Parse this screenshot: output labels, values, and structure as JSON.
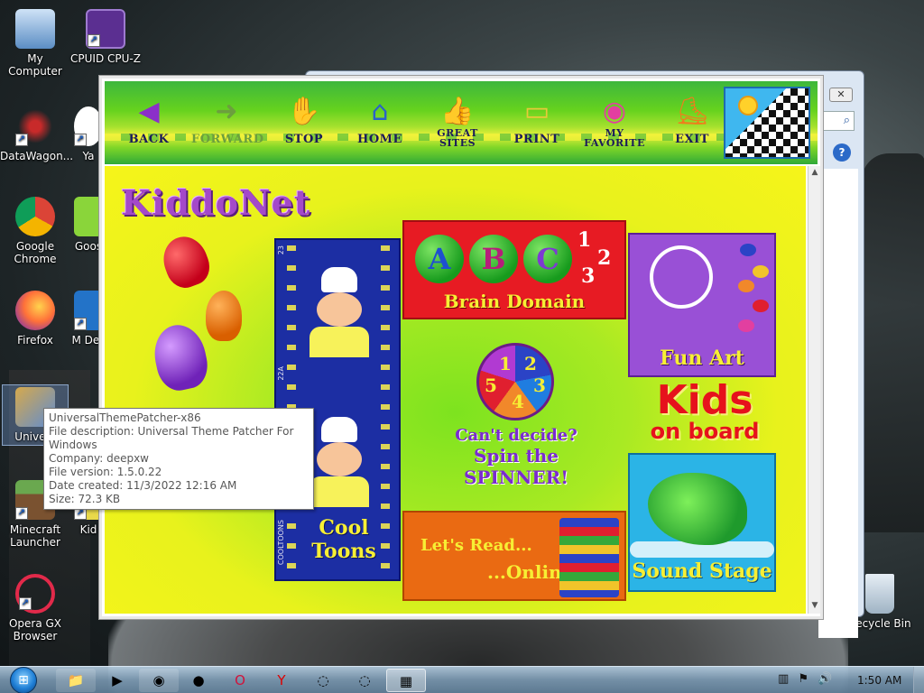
{
  "desktop": {
    "icons": [
      {
        "label": "My Computer",
        "icon": "computer-icon"
      },
      {
        "label": "CPUID CPU-Z",
        "icon": "cpu-z-icon"
      },
      {
        "label": "DataWagon...",
        "icon": "datawagon-icon"
      },
      {
        "label": "Ya",
        "icon": "yandex-icon"
      },
      {
        "label": "Google Chrome",
        "icon": "chrome-icon"
      },
      {
        "label": "Goos",
        "icon": "goose-icon"
      },
      {
        "label": "Firefox",
        "icon": "firefox-icon"
      },
      {
        "label": "M Des",
        "icon": "app-icon"
      },
      {
        "label": "Univers",
        "icon": "theme-patcher-icon"
      },
      {
        "label": "Minecraft Launcher",
        "icon": "minecraft-icon"
      },
      {
        "label": "Kid",
        "icon": "kiddonet-icon"
      },
      {
        "label": "Opera GX Browser",
        "icon": "opera-gx-icon"
      },
      {
        "label": "Recycle Bin",
        "icon": "recycle-bin-icon"
      }
    ]
  },
  "tooltip": {
    "title": "UniversalThemePatcher-x86",
    "description": "File description: Universal Theme Patcher For Windows",
    "company": "Company: deepxw",
    "version": "File version: 1.5.0.22",
    "created": "Date created: 11/3/2022 12:16 AM",
    "size": "Size: 72.3 KB"
  },
  "kiddonet": {
    "toolbar": {
      "back": "BACK",
      "forward": "FORWARD",
      "stop": "STOP",
      "home": "HOME",
      "great_sites_1": "GREAT",
      "great_sites_2": "SITES",
      "print": "PRINT",
      "favorite_1": "MY",
      "favorite_2": "FAVORITE",
      "exit": "EXIT"
    },
    "title": "KiddoNet",
    "toons": {
      "label_1": "Cool",
      "label_2": "Toons",
      "side_1": "23",
      "side_2": "22A",
      "side_3": "22",
      "side_4": "COOLTOONS"
    },
    "abc": {
      "a": "A",
      "b": "B",
      "c": "C",
      "n1": "1",
      "n2": "2",
      "n3": "3",
      "label": "Brain Domain"
    },
    "fun_art": {
      "label": "Fun Art",
      "brand": "Kids"
    },
    "spinner": {
      "n1": "1",
      "n2": "2",
      "n3": "3",
      "n4": "4",
      "n5": "5",
      "line1": "Can't decide?",
      "line2": "Spin the",
      "line3": "SPINNER!"
    },
    "kids_on_board": {
      "big": "Kids",
      "small": "on board"
    },
    "read": {
      "line1": "Let's Read...",
      "line2": "...Online!"
    },
    "sound_stage": {
      "label": "Sound Stage"
    }
  },
  "taskbar": {
    "apps": [
      "explorer-icon",
      "media-player-icon",
      "chrome-icon",
      "firefox-icon",
      "opera-icon",
      "yandex-icon",
      "launcher-icon",
      "launcher-icon",
      "kiddonet-icon"
    ],
    "clock": "1:50 AM"
  },
  "colors": {
    "accent_green": "#66d21e",
    "accent_yellow": "#f7ef34",
    "taskbar": "#6f8fa8"
  }
}
